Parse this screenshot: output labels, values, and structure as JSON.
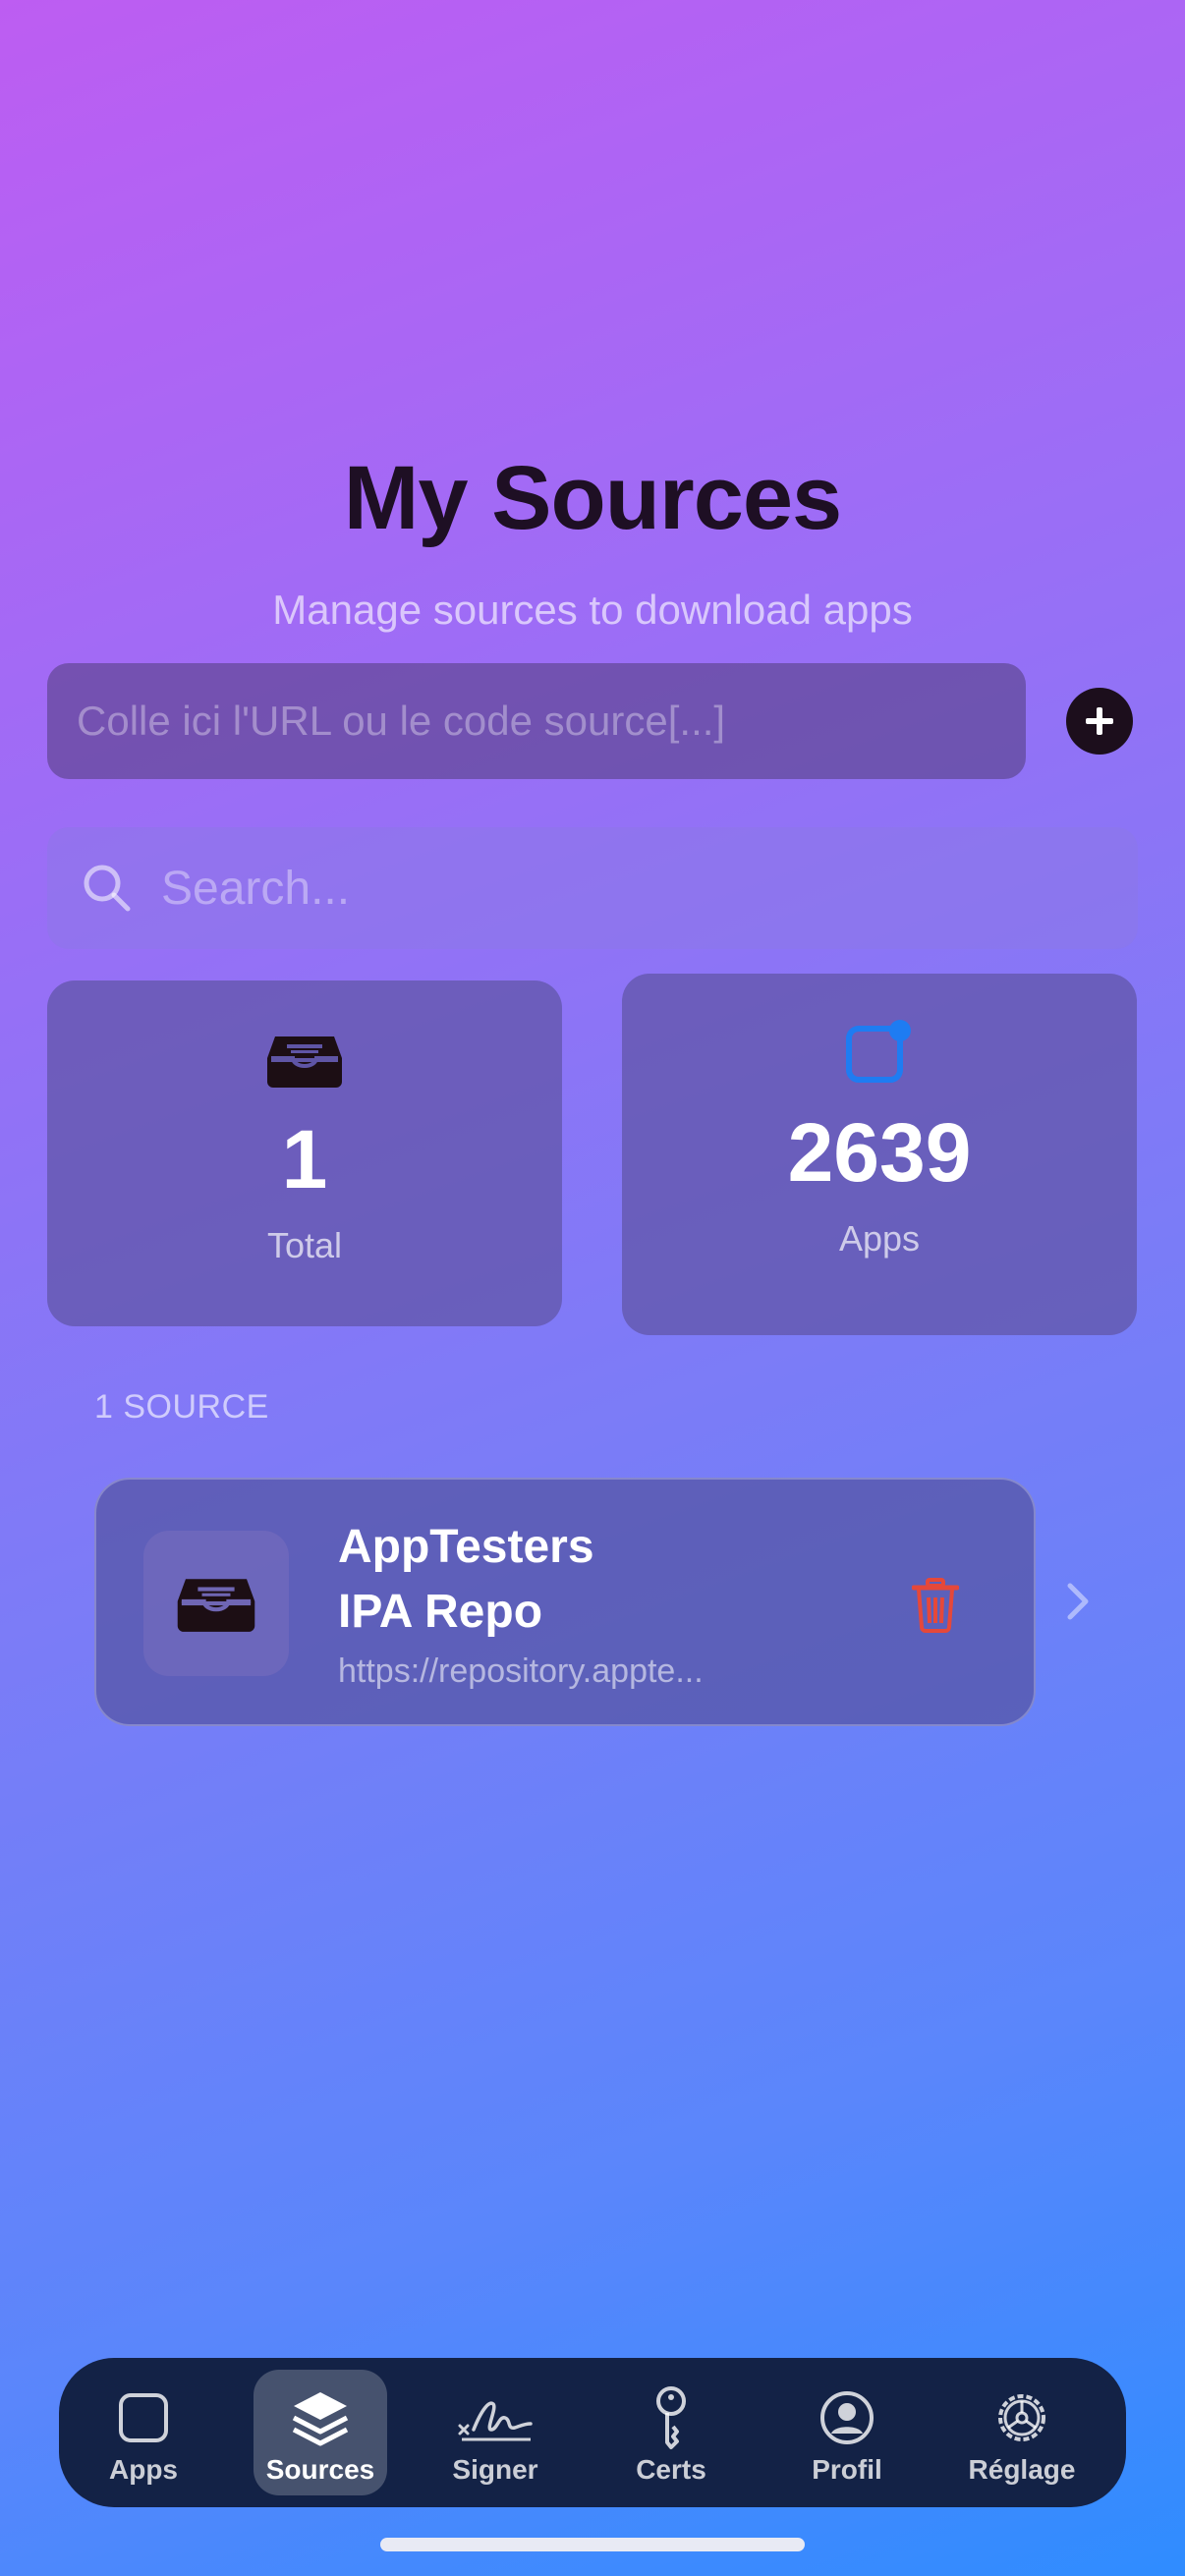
{
  "header": {
    "title": "My Sources",
    "subtitle": "Manage sources to download apps"
  },
  "url_input": {
    "placeholder": "Colle ici l'URL ou le code source[...]",
    "value": ""
  },
  "add_button": {
    "icon": "plus-circle-icon"
  },
  "search": {
    "placeholder": "Search...",
    "value": "",
    "icon": "search-icon"
  },
  "stats": {
    "total": {
      "value": "1",
      "label": "Total",
      "icon": "tray-icon"
    },
    "apps": {
      "value": "2639",
      "label": "Apps",
      "icon": "app-badge-icon",
      "icon_color": "#1e7cf2"
    }
  },
  "section": {
    "header": "1 SOURCE"
  },
  "sources": [
    {
      "name_line1": "AppTesters",
      "name_line2": "IPA Repo",
      "url": "https://repository.appte...",
      "icon": "tray-icon",
      "delete_icon": "trash-icon",
      "delete_color": "#e5483a"
    }
  ],
  "tabbar": {
    "active_index": 1,
    "tabs": [
      {
        "label": "Apps",
        "icon": "app-square-icon"
      },
      {
        "label": "Sources",
        "icon": "stack-icon"
      },
      {
        "label": "Signer",
        "icon": "signature-icon"
      },
      {
        "label": "Certs",
        "icon": "key-icon"
      },
      {
        "label": "Profil",
        "icon": "person-circle-icon"
      },
      {
        "label": "Réglage",
        "icon": "gear-icon"
      }
    ]
  }
}
